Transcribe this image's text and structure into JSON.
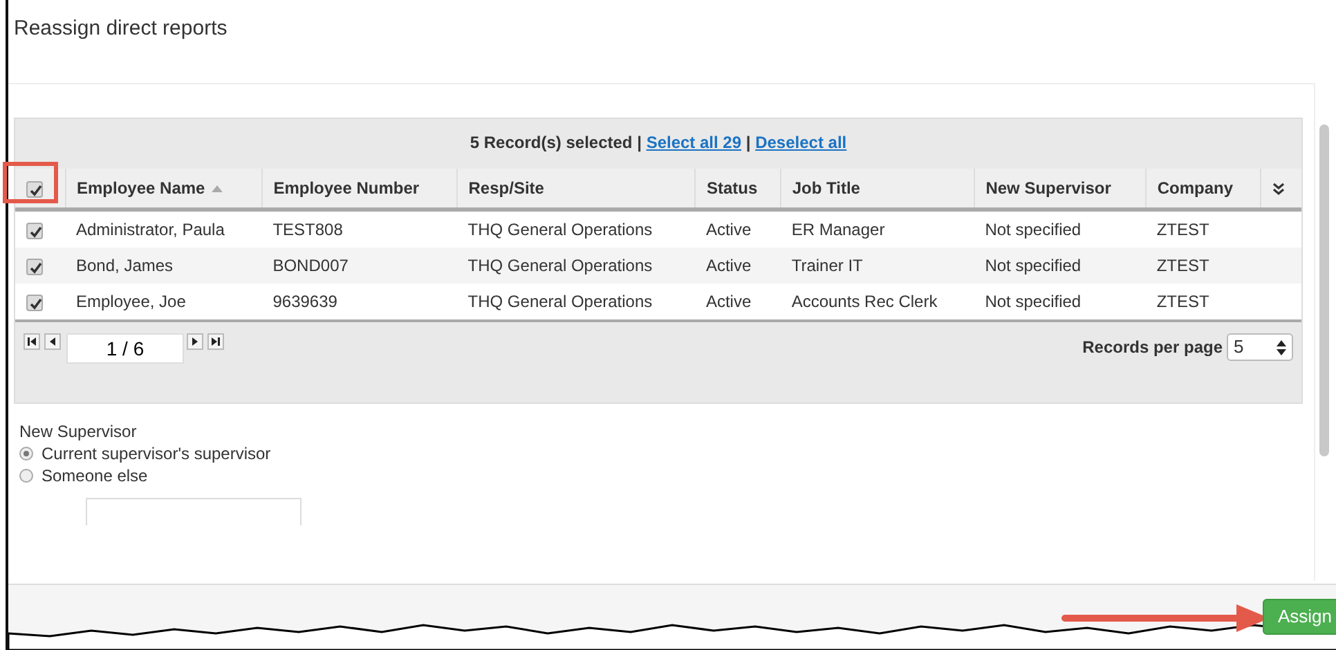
{
  "dialog": {
    "title": "Reassign direct reports"
  },
  "selection_bar": {
    "count_text": "5 Record(s) selected",
    "separator_1": "|",
    "select_all_link": "Select all 29",
    "separator_2": "|",
    "deselect_all_link": "Deselect all"
  },
  "table": {
    "select_all_checked": true,
    "columns": [
      {
        "label": "Employee Name",
        "sorted": true
      },
      {
        "label": "Employee Number",
        "sorted": false
      },
      {
        "label": "Resp/Site",
        "sorted": false
      },
      {
        "label": "Status",
        "sorted": false
      },
      {
        "label": "Job Title",
        "sorted": false
      },
      {
        "label": "New Supervisor",
        "sorted": false
      },
      {
        "label": "Company",
        "sorted": false
      }
    ],
    "rows": [
      {
        "checked": true,
        "cells": [
          "Administrator, Paula",
          "TEST808",
          "THQ General Operations",
          "Active",
          "ER Manager",
          "Not specified",
          "ZTEST"
        ]
      },
      {
        "checked": true,
        "cells": [
          "Bond, James",
          "BOND007",
          "THQ General Operations",
          "Active",
          "Trainer IT",
          "Not specified",
          "ZTEST"
        ]
      },
      {
        "checked": true,
        "cells": [
          "Employee, Joe",
          "9639639",
          "THQ General Operations",
          "Active",
          "Accounts Rec Clerk",
          "Not specified",
          "ZTEST"
        ]
      }
    ]
  },
  "pager": {
    "page": "1 / 6",
    "records_per_page_label": "Records per page",
    "records_per_page": "5"
  },
  "new_supervisor": {
    "label": "New Supervisor",
    "options": [
      {
        "label": "Current supervisor's supervisor",
        "selected": true
      },
      {
        "label": "Someone else",
        "selected": false
      }
    ]
  },
  "footer": {
    "assign_button": "Assign"
  }
}
